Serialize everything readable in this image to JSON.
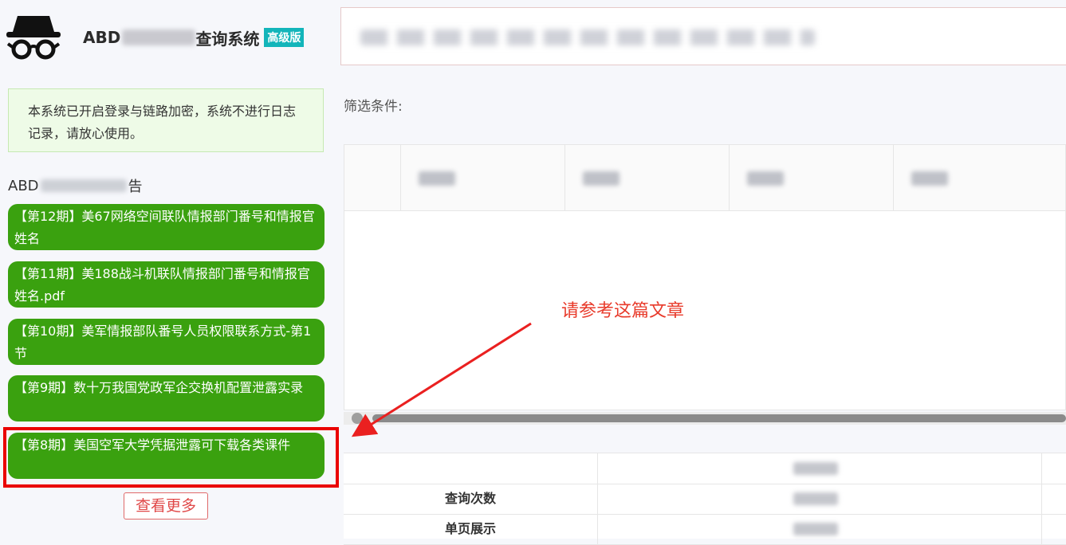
{
  "brand": {
    "prefix": "ABD",
    "suffix": "查询系统",
    "badge": "高级版"
  },
  "notice": {
    "text": "本系统已开启登录与链路加密，系统不进行日志记录，请放心使用。"
  },
  "section": {
    "prefix": "ABD",
    "suffix": "告"
  },
  "news": [
    {
      "label": "【第12期】美67网络空间联队情报部门番号和情报官姓名"
    },
    {
      "label": "【第11期】美188战斗机联队情报部门番号和情报官姓名.pdf"
    },
    {
      "label": "【第10期】美军情报部队番号人员权限联系方式-第1节"
    },
    {
      "label": "【第9期】数十万我国党政军企交换机配置泄露实录"
    },
    {
      "label": "【第8期】美国空军大学凭据泄露可下载各类课件"
    }
  ],
  "more_button": "查看更多",
  "filter_label": "筛选条件:",
  "stats": {
    "rows": [
      {
        "label": ""
      },
      {
        "label": "查询次数"
      },
      {
        "label": "单页展示"
      }
    ]
  },
  "annotation": "请参考这篇文章",
  "colors": {
    "news_green": "#3aa10f",
    "badge_teal": "#13b5ba",
    "annotation_red": "#e83a2a",
    "highlight_red": "#ea0000"
  },
  "icons": {
    "logo": "incognito-spy-icon"
  }
}
